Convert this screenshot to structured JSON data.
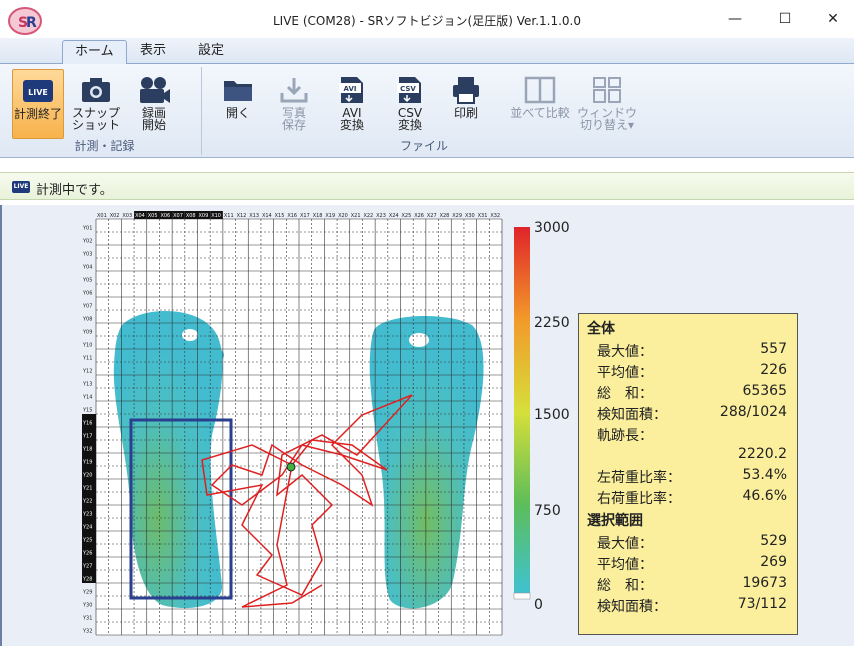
{
  "window": {
    "title": "LIVE (COM28) - SRソフトビジョン(足圧版) Ver.1.1.0.0",
    "minimize": "—",
    "maximize": "☐",
    "close": "✕"
  },
  "tabs": [
    "ホーム",
    "表示",
    "設定"
  ],
  "ribbon": {
    "group_measure": {
      "label": "計測・記録",
      "buttons": [
        "計測終了",
        "スナップ\nショット",
        "録画\n開始"
      ]
    },
    "group_file": {
      "label": "ファイル",
      "buttons": [
        "開く",
        "写真\n保存",
        "AVI\n変換",
        "CSV\n変換",
        "印刷",
        "並べて比較",
        "ウィンドウ\n切り替え▾"
      ]
    },
    "icon_live": "LIVE",
    "icon_avi": "AVI",
    "icon_csv": "CSV"
  },
  "status": {
    "icon": "LIVE",
    "text": "計測中です。"
  },
  "grid": {
    "col_labels": [
      "X01",
      "X02",
      "X03",
      "X04",
      "X05",
      "X06",
      "X07",
      "X08",
      "X09",
      "X10",
      "X11",
      "X12",
      "X13",
      "X14",
      "X15",
      "X16",
      "X17",
      "X18",
      "X19",
      "X20",
      "X21",
      "X22",
      "X23",
      "X24",
      "X25",
      "X26",
      "X27",
      "X28",
      "X29",
      "X30",
      "X31",
      "X32"
    ],
    "row_labels": [
      "Y01",
      "Y02",
      "Y03",
      "Y04",
      "Y05",
      "Y06",
      "Y07",
      "Y08",
      "Y09",
      "Y10",
      "Y11",
      "Y12",
      "Y13",
      "Y14",
      "Y15",
      "Y16",
      "Y17",
      "Y18",
      "Y19",
      "Y20",
      "Y21",
      "Y22",
      "Y23",
      "Y24",
      "Y25",
      "Y26",
      "Y27",
      "Y28",
      "Y29",
      "Y30",
      "Y31",
      "Y32"
    ]
  },
  "colorbar": {
    "ticks": [
      "3000",
      "2250",
      "1500",
      "750",
      "0"
    ]
  },
  "stats": {
    "overall_title": "全体",
    "overall": [
      {
        "k": "最大値：",
        "v": "557"
      },
      {
        "k": "平均値：",
        "v": "226"
      },
      {
        "k": "総　和：",
        "v": "65365"
      },
      {
        "k": "検知面積：",
        "v": "288/1024"
      },
      {
        "k": "軌跡長：",
        "v": ""
      },
      {
        "k": "",
        "v": "2220.2"
      },
      {
        "k": "左荷重比率：",
        "v": "53.4%"
      },
      {
        "k": "右荷重比率：",
        "v": "46.6%"
      }
    ],
    "selection_title": "選択範囲",
    "selection": [
      {
        "k": "最大値：",
        "v": "529"
      },
      {
        "k": "平均値：",
        "v": "269"
      },
      {
        "k": "総　和：",
        "v": "19673"
      },
      {
        "k": "検知面積：",
        "v": "73/112"
      }
    ]
  },
  "colors": {
    "accent": "#f7b24c",
    "trace": "#e02020",
    "selection": "#2a3f8f",
    "foot": "#4fc0c8"
  }
}
